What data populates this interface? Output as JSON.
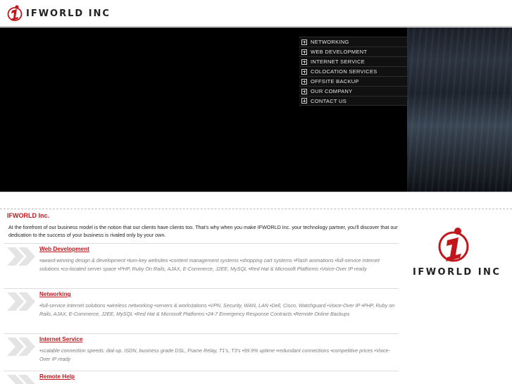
{
  "brand": {
    "name": "IFWORLD INC",
    "accent": "#c0161c"
  },
  "nav": {
    "items": [
      {
        "label": "NETWORKING"
      },
      {
        "label": "WEB DEVELOPMENT"
      },
      {
        "label": "INTERNET SERVICE"
      },
      {
        "label": "COLOCATION SERVICES"
      },
      {
        "label": "OFFSITE BACKUP"
      },
      {
        "label": "OUR COMPANY"
      },
      {
        "label": "CONTACT US"
      }
    ]
  },
  "content": {
    "title": "IFWORLD Inc.",
    "intro": "At the forefront of our business model is the notion that our clients have clients too. That's why when you make IFWORLD Inc. your technology partner, you'll discover that our dedication to the success of your business is rivaled only by your own.",
    "sections": [
      {
        "title": "Web Development",
        "desc": "•award-winning design & development •turn-key websites •content management systems •shopping cart systems •Flash animations •full-service Internet solutions •co-located server space •PHP, Ruby On Rails, AJAX, E-Commerce, J2EE, MySQL •Red Hat & Microsoft Platforms •Voice-Over IP ready"
      },
      {
        "title": "Networking",
        "desc": "•full-service Internet solutions •wireless networking •servers & workstations •VPN, Security, WAN, LAN •Dell, Cisco, Watchguard •Voice-Over IP •PHP, Ruby on Rails, AJAX, E-Commerce, J2EE, MySQL •Red Hat & Microsoft Platforms •24-7 Emergency Response Contracts •Remote Online Backups"
      },
      {
        "title": "Internet Service",
        "desc": "•scalable connection speeds: dial-up, ISDN, business grade DSL, Frame Relay, T1's, T3's •99.9% uptime •redundant connections •competitive prices •Voice-Over IP ready"
      },
      {
        "title": "Remote Help",
        "desc": ""
      }
    ]
  },
  "icons": {
    "logo": "ifworld-logo-icon",
    "bullet": "double-chevron-icon",
    "nav": "plus-box-icon"
  }
}
